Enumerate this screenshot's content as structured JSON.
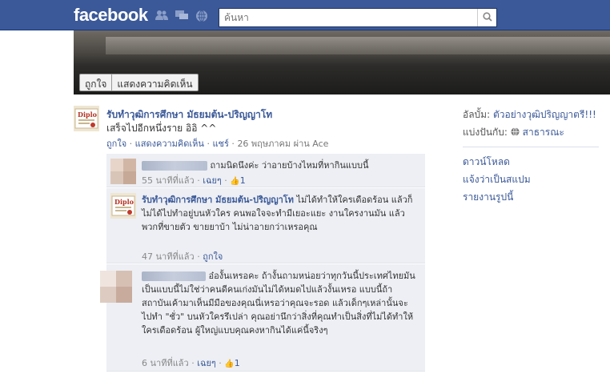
{
  "topbar": {
    "logo": "facebook",
    "search_placeholder": "ค้นหา",
    "search_value": "",
    "icons": [
      "friend-requests-icon",
      "messages-icon",
      "notifications-icon",
      "search-icon"
    ]
  },
  "photo": {
    "like_label": "ถูกใจ",
    "comment_label": "แสดงความคิดเห็น"
  },
  "post": {
    "author": "รับทำวุฒิการศึกษา มัธยมต้น-ปริญญาโท",
    "text": "เสร็จไปอีกหนึ่งราย อิอิ ^^",
    "like_link": "ถูกใจ",
    "comment_link": "แสดงความคิดเห็น",
    "share_link": "แชร์",
    "date": "26 พฤษภาคม ผ่าน Ace",
    "sep": " · "
  },
  "comments": [
    {
      "name": "",
      "text": "ถามนิดนึงค่ะ ว่าอายบ้างไหมที่หากินแบบนี้",
      "time": "55 นาทีที่แล้ว",
      "action": "เฉยๆ",
      "likes": "1"
    },
    {
      "name": "รับทำวุฒิการศึกษา มัธยมต้น-ปริญญาโท",
      "text": "ไม่ได้ทำให้ใครเดือดร้อน แล้วก็ไม่ได้ไปทำอยู่บนหัวใคร คนพอใจจะทำมีเยอะแยะ งานใครงานมัน แล้วพวกที่ขายตัว ขายยาบ้า ไม่น่าอายกว่าเหรอคุณ",
      "time": "47 นาทีที่แล้ว",
      "action": "ถูกใจ",
      "likes": ""
    },
    {
      "name": "",
      "text": "อ๋องั้นเหรอคะ ถ้างั้นถามหน่อยว่าทุกวันนี้ประเทศไทยมันเป็นแบบนี้ไม่ใช่ว่าคนดีคนเก่งมันไม่ได้หมดไปแล้วงั้นเหรอ แบบนี้ถ้าสถาบันเค้ามาเห็นมีมือของคุณนี่เหรอว่าคุณจะรอด แล้วเด็กๆเหล่านั้นจะไปทำ \"ชั่ว\" บนหัวใครรึเปล่า คุณอย่านึกว่าสิ่งที่คุณทำเป็นสิ่งที่ไม่ได้ทำให้ใครเดือดร้อน ผู้ใหญ่แบบคุณคงหากินได้แค่นี้จริงๆ",
      "time": "6 นาทีที่แล้ว",
      "action": "เฉยๆ",
      "likes": "1"
    }
  ],
  "sidebar": {
    "album_prefix": "อัลบั้ม:",
    "album_name": "ตัวอย่างวุฒิปริญญาตรี!!!",
    "share_prefix": "แบ่งปันกับ:",
    "share_value": "สาธารณะ",
    "actions": [
      "ดาวน์โหลด",
      "แจ้งว่าเป็นสแปม",
      "รายงานรูปนี้"
    ]
  },
  "colors": {
    "brand": "#3b5998",
    "comment_bg": "#edeff4"
  }
}
